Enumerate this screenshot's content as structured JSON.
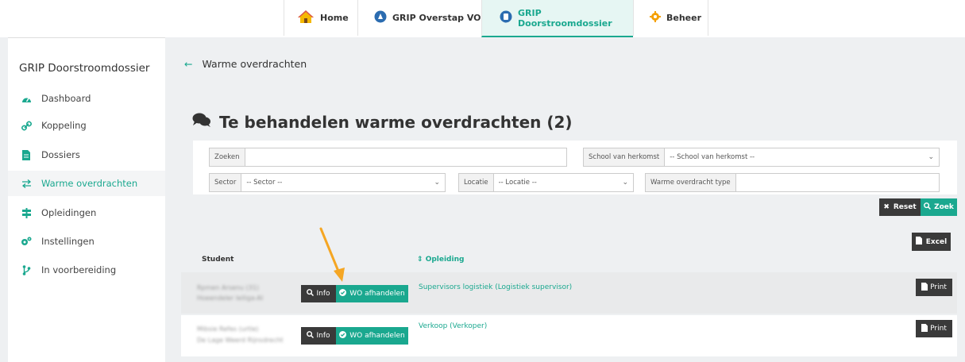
{
  "nav": {
    "tabs": [
      {
        "label": "Home",
        "icon": "home-icon"
      },
      {
        "label": "GRIP Overstap VO",
        "icon": "overstap-icon"
      },
      {
        "label": "GRIP Doorstroomdossier",
        "icon": "doorstroom-icon"
      },
      {
        "label": "Beheer",
        "icon": "gear-icon"
      }
    ],
    "active_index": 2
  },
  "sidebar": {
    "title": "GRIP Doorstroomdossier",
    "items": [
      {
        "label": "Dashboard",
        "icon": "dashboard-icon"
      },
      {
        "label": "Koppeling",
        "icon": "link-icon"
      },
      {
        "label": "Dossiers",
        "icon": "file-icon"
      },
      {
        "label": "Warme overdrachten",
        "icon": "exchange-icon"
      },
      {
        "label": "Opleidingen",
        "icon": "signpost-icon"
      },
      {
        "label": "Instellingen",
        "icon": "cogs-icon"
      },
      {
        "label": "In voorbereiding",
        "icon": "branch-icon"
      }
    ],
    "active_index": 3
  },
  "back_link": "Warme overdrachten",
  "page_title": "Te behandelen warme overdrachten (2)",
  "filters": {
    "zoeken_label": "Zoeken",
    "zoeken_value": "",
    "school_label": "School van herkomst",
    "school_value": "-- School van herkomst --",
    "sector_label": "Sector",
    "sector_value": "-- Sector --",
    "locatie_label": "Locatie",
    "locatie_value": "-- Locatie --",
    "type_label": "Warme overdracht type",
    "type_value": ""
  },
  "buttons": {
    "reset": "Reset",
    "zoek": "Zoek",
    "excel": "Excel",
    "info": "Info",
    "wo_afhandelen": "WO afhandelen",
    "print": "Print"
  },
  "table": {
    "columns": [
      "Student",
      "Opleiding"
    ],
    "sort_indicator": "⇕",
    "rows": [
      {
        "student_name": "Rpmen Arsenu (31)",
        "student_school": "Hoeendeler leiliga-AI",
        "opleiding": "Supervisors logistiek (Logistiek supervisor)"
      },
      {
        "student_name": "Mibsie Refes (urtle)",
        "student_school": "De Lage Weerd Rijnsdrecht",
        "opleiding": "Verkoop (Verkoper)"
      }
    ]
  },
  "colors": {
    "accent": "#1aa88f",
    "dark_button": "#3a3a3a",
    "annotation_arrow": "#f5a623"
  }
}
